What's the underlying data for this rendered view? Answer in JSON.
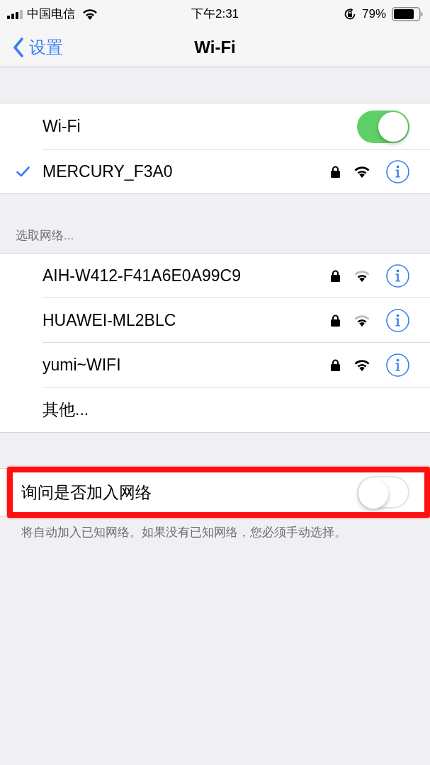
{
  "status_bar": {
    "carrier": "中国电信",
    "time": "下午2:31",
    "battery": "79%"
  },
  "nav": {
    "back": "设置",
    "title": "Wi-Fi"
  },
  "wifi": {
    "label": "Wi-Fi",
    "on": true
  },
  "current_network": {
    "name": "MERCURY_F3A0",
    "selected": true,
    "locked": true,
    "weak_signal": false
  },
  "networks_header": "选取网络...",
  "networks": [
    {
      "kind": "network",
      "name": "AIH-W412-F41A6E0A99C9",
      "locked": true,
      "weak_signal": true
    },
    {
      "kind": "network",
      "name": "HUAWEI-ML2BLC",
      "locked": true,
      "weak_signal": true
    },
    {
      "kind": "network",
      "name": "yumi~WIFI",
      "locked": true,
      "weak_signal": false
    },
    {
      "kind": "other",
      "name": "其他..."
    }
  ],
  "ask_to_join": {
    "label": "询问是否加入网络",
    "on": false,
    "highlighted": true
  },
  "footer": "将自动加入已知网络。如果没有已知网络，您必须手动选择。"
}
